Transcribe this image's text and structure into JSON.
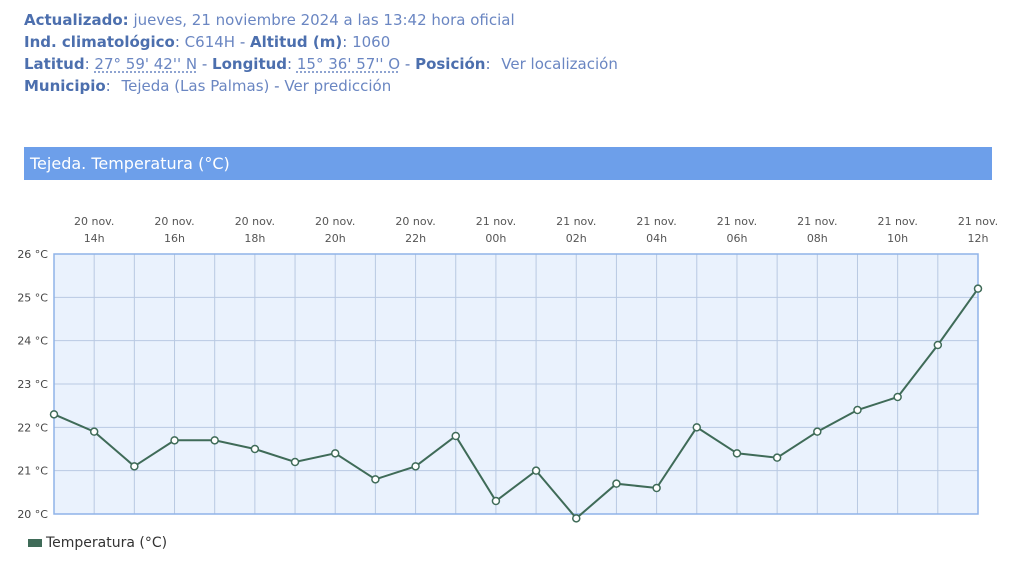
{
  "station": {
    "updated_label": "Actualizado:",
    "updated_value": "jueves, 21 noviembre 2024 a las 13:42 hora oficial",
    "climate_label": "Ind. climatológico",
    "climate_value": "C614H",
    "altitude_label": "Altitud (m)",
    "altitude_value": "1060",
    "lat_label": "Latitud",
    "lat_value": "27° 59' 42'' N",
    "lon_label": "Longitud",
    "lon_value": "15° 36' 57'' O",
    "position_label": "Posición",
    "position_link": "Ver localización",
    "municipality_label": "Municipio",
    "municipality_value": "Tejeda (Las Palmas)",
    "forecast_link": "Ver predicción"
  },
  "chart_title": "Tejeda. Temperatura (°C)",
  "colors": {
    "line": "#3f6b58",
    "plot_bg": "#eaf2fd",
    "axis": "#8fb3e8",
    "banner": "#6d9fea"
  },
  "chart_data": {
    "type": "line",
    "title": "Tejeda. Temperatura (°C)",
    "ylim": [
      20,
      26
    ],
    "y_ticks": [
      "26 °C",
      "25 °C",
      "24 °C",
      "23 °C",
      "22 °C",
      "21 °C",
      "20 °C"
    ],
    "x_ticks": [
      [
        "20 nov.",
        "14h"
      ],
      [
        "20 nov.",
        "16h"
      ],
      [
        "20 nov.",
        "18h"
      ],
      [
        "20 nov.",
        "20h"
      ],
      [
        "20 nov.",
        "22h"
      ],
      [
        "21 nov.",
        "00h"
      ],
      [
        "21 nov.",
        "02h"
      ],
      [
        "21 nov.",
        "04h"
      ],
      [
        "21 nov.",
        "06h"
      ],
      [
        "21 nov.",
        "08h"
      ],
      [
        "21 nov.",
        "10h"
      ],
      [
        "21 nov.",
        "12h"
      ]
    ],
    "grid": true,
    "legend": "bottom-left",
    "series": [
      {
        "name": "Temperatura (°C)",
        "values": [
          22.3,
          21.9,
          21.1,
          21.7,
          21.7,
          21.5,
          21.2,
          21.4,
          20.8,
          21.1,
          21.8,
          20.3,
          21.0,
          19.9,
          20.7,
          20.6,
          22.0,
          21.4,
          21.3,
          21.9,
          22.4,
          22.7,
          23.9,
          25.2
        ]
      }
    ]
  }
}
